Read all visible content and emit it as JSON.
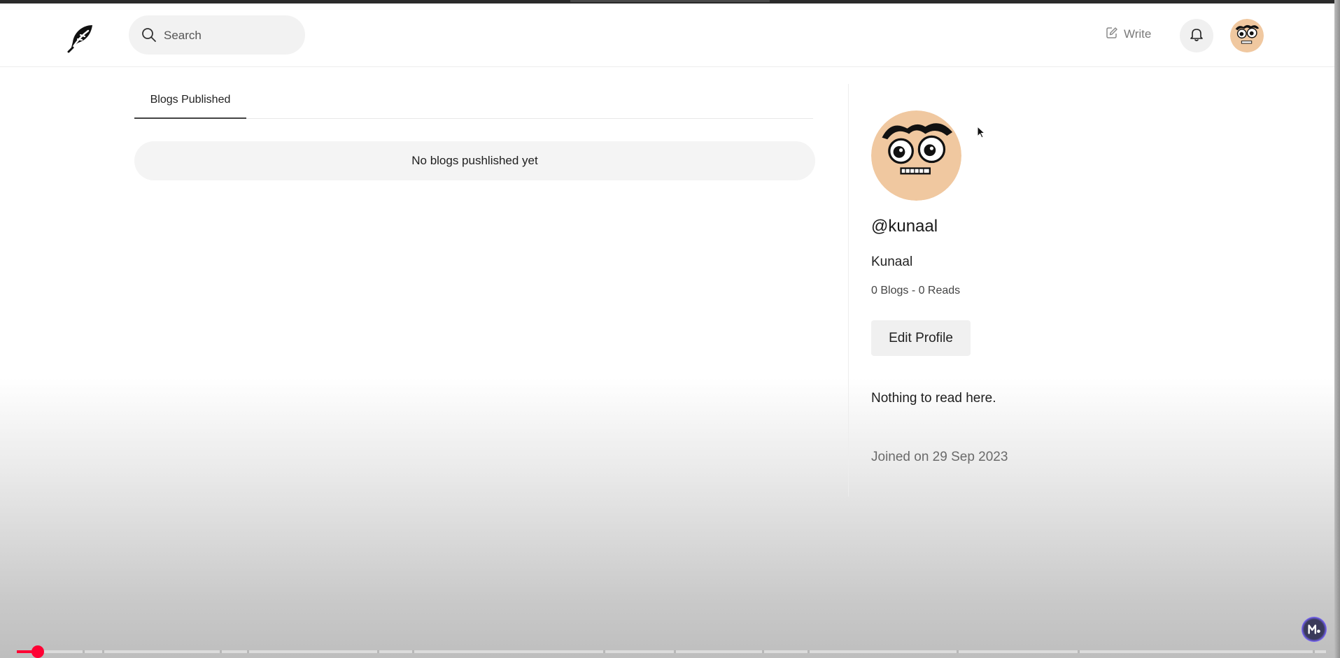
{
  "navbar": {
    "search_placeholder": "Search",
    "write_label": "Write",
    "logo_icon": "feather-icon",
    "bell_icon": "bell-icon"
  },
  "tabs": [
    {
      "label": "Blogs Published",
      "active": true
    }
  ],
  "main": {
    "empty_message": "No blogs pushlished yet"
  },
  "profile": {
    "username": "@kunaal",
    "fullname": "Kunaal",
    "stats": "0 Blogs - 0 Reads",
    "edit_button_label": "Edit Profile",
    "bio": "Nothing to read here.",
    "joined": "Joined on 29 Sep 2023",
    "avatar_icon": "cartoon-face-avatar"
  },
  "video_player": {
    "progress_fraction": 0.016,
    "chapter_marks": [
      0.05,
      0.065,
      0.155,
      0.176,
      0.275,
      0.302,
      0.448,
      0.502,
      0.569,
      0.604,
      0.718,
      0.81,
      0.99
    ],
    "accent_color": "#ff0033"
  },
  "colors": {
    "accent": "#ff0033",
    "avatar_skin": "#f0c8a0"
  }
}
